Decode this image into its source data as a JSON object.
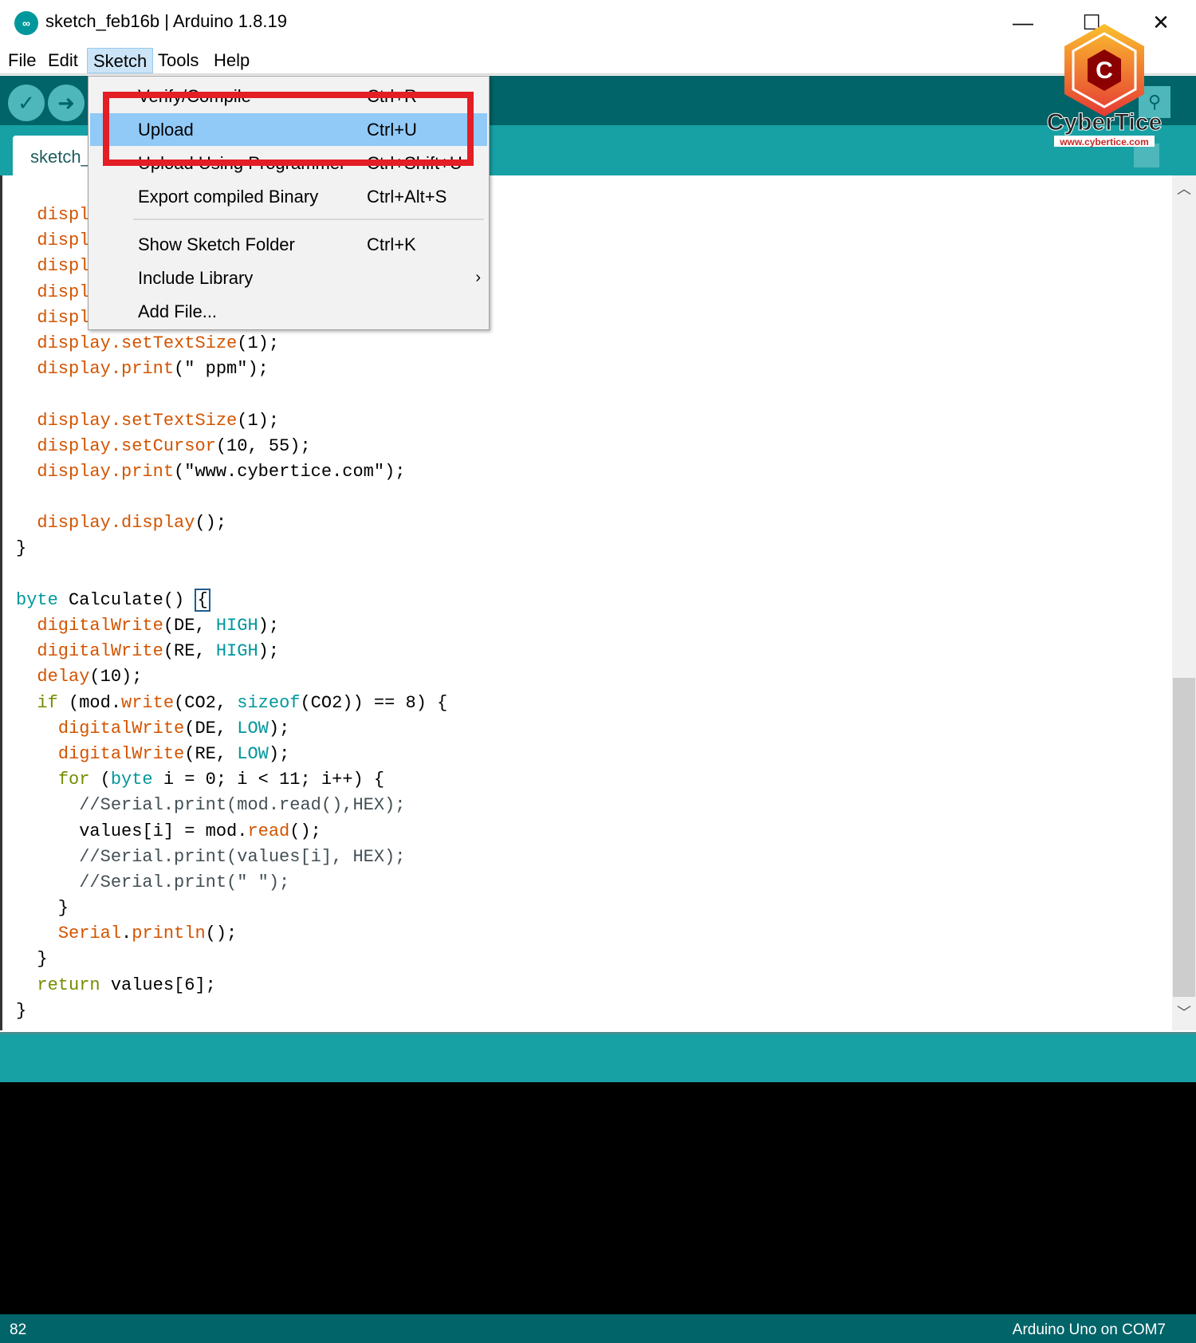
{
  "window": {
    "title": "sketch_feb16b | Arduino 1.8.19",
    "app_icon": "arduino-infinity-icon",
    "controls": [
      "minimize-icon",
      "maximize-icon",
      "close-icon"
    ]
  },
  "menubar": [
    "File",
    "Edit",
    "Sketch",
    "Tools",
    "Help"
  ],
  "toolbar": {
    "buttons": [
      "verify-check-icon",
      "upload-arrow-icon"
    ],
    "serial_monitor": "magnifier-icon"
  },
  "tab": {
    "label": "sketch_"
  },
  "sketch_menu": {
    "items": [
      {
        "label": "Verify/Compile",
        "shortcut": "Ctrl+R"
      },
      {
        "label": "Upload",
        "shortcut": "Ctrl+U",
        "highlighted": true
      },
      {
        "label": "Upload Using Programmer",
        "shortcut": "Ctrl+Shift+U"
      },
      {
        "label": "Export compiled Binary",
        "shortcut": "Ctrl+Alt+S"
      },
      {
        "label": "Show Sketch Folder",
        "shortcut": "Ctrl+K"
      },
      {
        "label": "Include Library",
        "shortcut": "",
        "submenu": true
      },
      {
        "label": "Add File...",
        "shortcut": ""
      }
    ],
    "annotation_color": "#e31e24"
  },
  "code_lines": [
    [
      [
        "  ",
        ""
      ],
      [
        "displ",
        "fn"
      ]
    ],
    [
      [
        "  ",
        ""
      ],
      [
        "displ",
        "fn"
      ]
    ],
    [
      [
        "  ",
        ""
      ],
      [
        "displ",
        "fn"
      ]
    ],
    [
      [
        "  ",
        ""
      ],
      [
        "displ",
        "fn"
      ]
    ],
    [
      [
        "  ",
        ""
      ],
      [
        "displ",
        "fn"
      ]
    ],
    [
      [
        "  ",
        ""
      ],
      [
        "display.setTextSize",
        "fn"
      ],
      [
        "(1);",
        ""
      ]
    ],
    [
      [
        "  ",
        ""
      ],
      [
        "display.print",
        "fn"
      ],
      [
        "(\" ppm\");",
        ""
      ]
    ],
    [],
    [
      [
        "  ",
        ""
      ],
      [
        "display.setTextSize",
        "fn"
      ],
      [
        "(1);",
        ""
      ]
    ],
    [
      [
        "  ",
        ""
      ],
      [
        "display.setCursor",
        "fn"
      ],
      [
        "(10, 55);",
        ""
      ]
    ],
    [
      [
        "  ",
        ""
      ],
      [
        "display.print",
        "fn"
      ],
      [
        "(\"www.cybertice.com\");",
        ""
      ]
    ],
    [],
    [
      [
        "  ",
        ""
      ],
      [
        "display.display",
        "fn"
      ],
      [
        "();",
        ""
      ]
    ],
    [
      [
        "}",
        ""
      ]
    ],
    [],
    [
      [
        "byte",
        "ty"
      ],
      [
        " Calculate() ",
        ""
      ],
      [
        "{",
        "caret"
      ]
    ],
    [
      [
        "  ",
        ""
      ],
      [
        "digitalWrite",
        "fn"
      ],
      [
        "(DE, ",
        ""
      ],
      [
        "HIGH",
        "ty"
      ],
      [
        ");",
        ""
      ]
    ],
    [
      [
        "  ",
        ""
      ],
      [
        "digitalWrite",
        "fn"
      ],
      [
        "(RE, ",
        ""
      ],
      [
        "HIGH",
        "ty"
      ],
      [
        ");",
        ""
      ]
    ],
    [
      [
        "  ",
        ""
      ],
      [
        "delay",
        "fn"
      ],
      [
        "(10);",
        ""
      ]
    ],
    [
      [
        "  ",
        ""
      ],
      [
        "if",
        "ct"
      ],
      [
        " (mod.",
        ""
      ],
      [
        "write",
        "fn"
      ],
      [
        "(CO2, ",
        ""
      ],
      [
        "sizeof",
        "ty"
      ],
      [
        "(CO2)) == 8) {",
        ""
      ]
    ],
    [
      [
        "    ",
        ""
      ],
      [
        "digitalWrite",
        "fn"
      ],
      [
        "(DE, ",
        ""
      ],
      [
        "LOW",
        "ty"
      ],
      [
        ");",
        ""
      ]
    ],
    [
      [
        "    ",
        ""
      ],
      [
        "digitalWrite",
        "fn"
      ],
      [
        "(RE, ",
        ""
      ],
      [
        "LOW",
        "ty"
      ],
      [
        ");",
        ""
      ]
    ],
    [
      [
        "    ",
        ""
      ],
      [
        "for",
        "ct"
      ],
      [
        " (",
        ""
      ],
      [
        "byte",
        "ty"
      ],
      [
        " i = 0; i < 11; i++) {",
        ""
      ]
    ],
    [
      [
        "      ",
        ""
      ],
      [
        "//Serial.print(mod.read(),HEX);",
        "cm"
      ]
    ],
    [
      [
        "      values[i] = mod.",
        ""
      ],
      [
        "read",
        "fn"
      ],
      [
        "();",
        ""
      ]
    ],
    [
      [
        "      ",
        ""
      ],
      [
        "//Serial.print(values[i], HEX);",
        "cm"
      ]
    ],
    [
      [
        "      ",
        ""
      ],
      [
        "//Serial.print(\" \");",
        "cm"
      ]
    ],
    [
      [
        "    }",
        ""
      ]
    ],
    [
      [
        "    ",
        ""
      ],
      [
        "Serial",
        "fn"
      ],
      [
        ".",
        ""
      ],
      [
        "println",
        "fn"
      ],
      [
        "();",
        ""
      ]
    ],
    [
      [
        "  }",
        ""
      ]
    ],
    [
      [
        "  ",
        ""
      ],
      [
        "return",
        "ct"
      ],
      [
        " values[6];",
        ""
      ]
    ],
    [
      [
        "}",
        ""
      ]
    ]
  ],
  "status": {
    "line": "82",
    "board": "Arduino Uno on COM7"
  },
  "watermark": {
    "brand": "CyberTice",
    "url": "www.cybertice.com"
  },
  "colors": {
    "toolbar": "#006468",
    "tabstrip": "#17a1a5",
    "function": "#d35400",
    "type": "#00979c",
    "control": "#728e00",
    "highlight": "#91c9f7"
  }
}
